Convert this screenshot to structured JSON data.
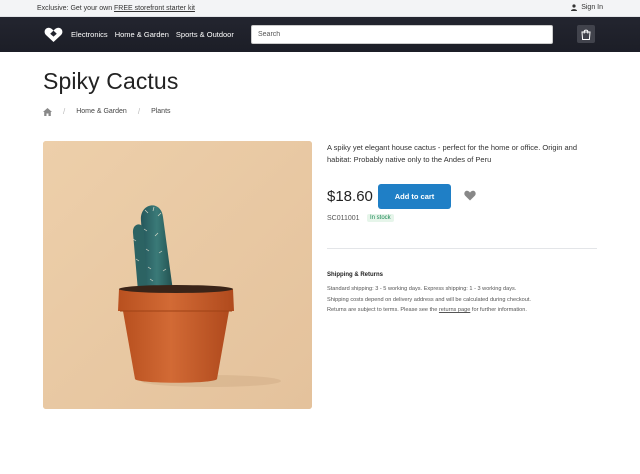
{
  "topbar": {
    "promo_prefix": "Exclusive: Get your own ",
    "promo_link": "FREE storefront starter kit",
    "signin": "Sign In"
  },
  "nav": {
    "links": [
      "Electronics",
      "Home & Garden",
      "Sports & Outdoor"
    ],
    "search_placeholder": "Search"
  },
  "product": {
    "title": "Spiky Cactus",
    "breadcrumb": [
      "Home & Garden",
      "Plants"
    ],
    "description": "A spiky yet elegant house cactus - perfect for the home or office. Origin and habitat: Probably native only to the Andes of Peru",
    "price": "$18.60",
    "add_to_cart": "Add to cart",
    "sku": "SC011001",
    "stock": "In stock"
  },
  "shipping": {
    "title": "Shipping & Returns",
    "line1": "Standard shipping: 3 - 5 working days. Express shipping: 1 - 3 working days.",
    "line2": "Shipping costs depend on delivery address and will be calculated during checkout.",
    "line3_prefix": "Returns are subject to terms. Please see the ",
    "line3_link": "returns page",
    "line3_suffix": " for further information."
  },
  "colors": {
    "navbar": "#1c1e27",
    "primary_button": "#1f7fc6",
    "image_background": "#e9c9a5",
    "pot": "#c8592a",
    "cactus": "#2f6b6a",
    "stock_badge": "#198754"
  },
  "icons": [
    "user-icon",
    "logo-heart-icon",
    "cart-icon",
    "home-icon",
    "wishlist-heart-icon"
  ]
}
